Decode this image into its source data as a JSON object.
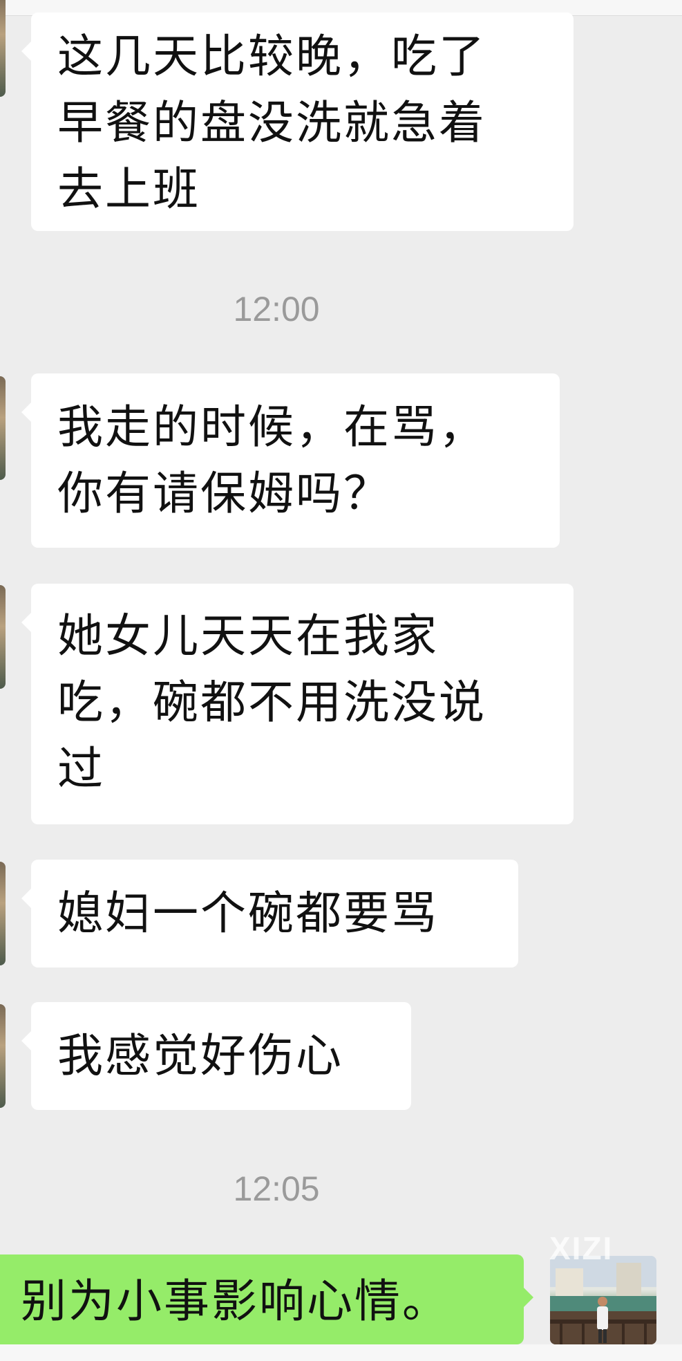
{
  "messages": [
    {
      "sender": "other",
      "text": "这几天比较晚，吃了\n早餐的盘没洗就急着\n去上班"
    },
    {
      "sender": "other",
      "text": "我走的时候，在骂，\n你有请保姆吗？"
    },
    {
      "sender": "other",
      "text": "她女儿天天在我家\n吃，碗都不用洗没说\n过"
    },
    {
      "sender": "other",
      "text": "媳妇一个碗都要骂"
    },
    {
      "sender": "other",
      "text": "我感觉好伤心"
    },
    {
      "sender": "self",
      "text": "别为小事影响心情。"
    }
  ],
  "timestamps": [
    "12:00",
    "12:05"
  ],
  "watermark": "XIZI",
  "colors": {
    "background": "#ededed",
    "incoming_bubble": "#ffffff",
    "outgoing_bubble": "#95ec69",
    "timestamp_text": "#9a9a9a"
  }
}
